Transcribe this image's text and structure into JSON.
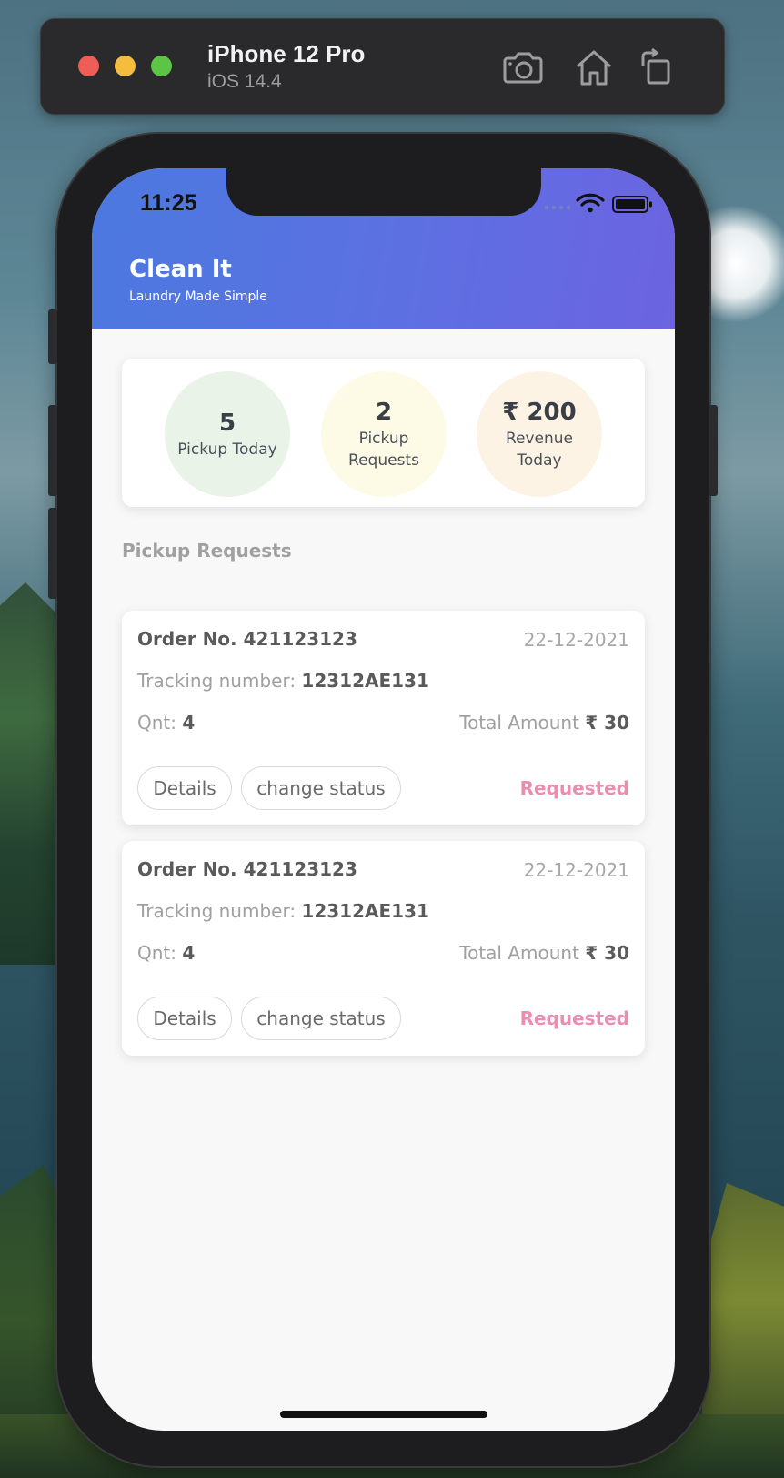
{
  "simulator": {
    "device": "iPhone 12 Pro",
    "os": "iOS 14.4",
    "icons": [
      "screenshot-icon",
      "home-icon",
      "rotate-icon"
    ]
  },
  "status_bar": {
    "time": "11:25"
  },
  "app": {
    "title": "Clean It",
    "subtitle": "Laundry Made Simple"
  },
  "stats": [
    {
      "value": "5",
      "label": "Pickup Today",
      "color": "#e9f3e8"
    },
    {
      "value": "2",
      "label": "Pickup Requests",
      "color": "#fdfbe6"
    },
    {
      "value": "₹ 200",
      "label": "Revenue Today",
      "color": "#fcf3e5"
    }
  ],
  "section_title": "Pickup Requests",
  "orders": [
    {
      "order_no": "Order No. 421123123",
      "date": "22-12-2021",
      "tracking_label": "Tracking number: ",
      "tracking_value": "12312AE131",
      "qty_label": "Qnt: ",
      "qty_value": "4",
      "total_label": "Total Amount ",
      "total_value": "₹ 30",
      "details_label": "Details",
      "change_label": "change status",
      "status": "Requested"
    },
    {
      "order_no": "Order No. 421123123",
      "date": "22-12-2021",
      "tracking_label": "Tracking number: ",
      "tracking_value": "12312AE131",
      "qty_label": "Qnt: ",
      "qty_value": "4",
      "total_label": "Total Amount ",
      "total_value": "₹ 30",
      "details_label": "Details",
      "change_label": "change status",
      "status": "Requested"
    }
  ],
  "colors": {
    "header_start": "#4b79df",
    "header_end": "#6c63e1",
    "status_requested": "#ea8eb0"
  }
}
